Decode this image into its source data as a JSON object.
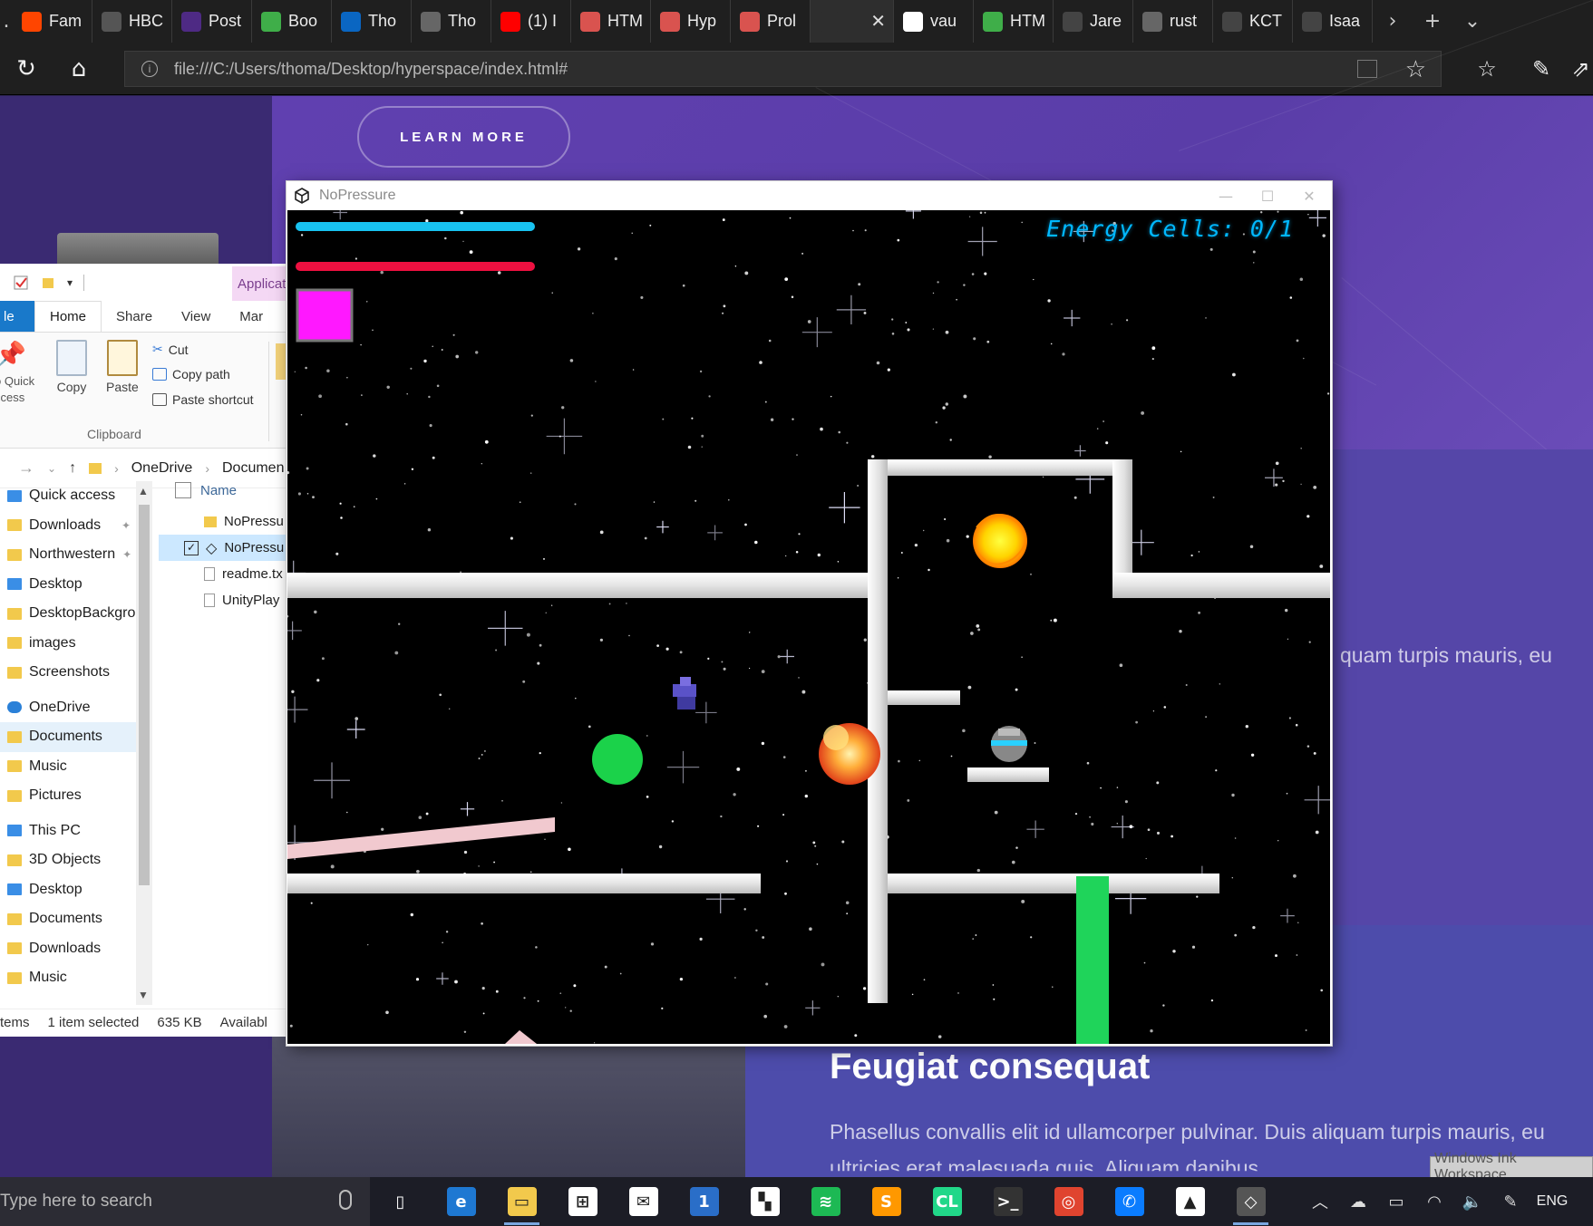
{
  "browser": {
    "tabs": [
      {
        "label": "Fam",
        "icon": "reddit-icon",
        "color": "#ff4500"
      },
      {
        "label": "HBC",
        "icon": "instagram-icon",
        "color": "#555555"
      },
      {
        "label": "Post",
        "icon": "northwestern-icon",
        "color": "#4e2a84"
      },
      {
        "label": "Boo",
        "icon": "html5up-icon",
        "color": "#3fae49"
      },
      {
        "label": "Tho",
        "icon": "linkedin-icon",
        "color": "#0a66c2"
      },
      {
        "label": "Tho",
        "icon": "pdf-icon",
        "color": "#666666"
      },
      {
        "label": "(1) I",
        "icon": "youtube-icon",
        "color": "#ff0000"
      },
      {
        "label": "HTM",
        "icon": "hsu-icon",
        "color": "#d9534f"
      },
      {
        "label": "Hyp",
        "icon": "hsu-icon",
        "color": "#d9534f"
      },
      {
        "label": "Prol",
        "icon": "hsu-icon",
        "color": "#d9534f"
      },
      {
        "label": "",
        "icon": "window-icon",
        "color": "#2e2e2e",
        "active": true
      },
      {
        "label": "vau",
        "icon": "google-icon",
        "color": "#ffffff"
      },
      {
        "label": "HTM",
        "icon": "html5up-icon",
        "color": "#3fae49"
      },
      {
        "label": "Jare",
        "icon": "terminal-icon",
        "color": "#444444"
      },
      {
        "label": "rust",
        "icon": "github-icon",
        "color": "#666666"
      },
      {
        "label": "KCT",
        "icon": "window-icon",
        "color": "#444444"
      },
      {
        "label": "Isaa",
        "icon": "window-icon",
        "color": "#444444"
      }
    ],
    "url": "file:///C:/Users/thoma/Desktop/hyperspace/index.html#"
  },
  "webpage": {
    "learn_more": "LEARN MORE",
    "snippet_right": "quam turpis mauris, eu",
    "heading": "Feugiat consequat",
    "para_line1": "Phasellus convallis elit id ullamcorper pulvinar. Duis aliquam turpis mauris, eu",
    "para_line2": "ultricies erat malesuada quis. Aliquam dapibus.",
    "ink_tooltip": "Windows Ink Workspace"
  },
  "explorer": {
    "tabs": {
      "file": "le",
      "home": "Home",
      "share": "Share",
      "view": "View",
      "manage": "Mar"
    },
    "application_tab": "Applicati",
    "ribbon": {
      "pin": "o Quick\nccess",
      "copy": "Copy",
      "paste": "Paste",
      "cut": "Cut",
      "copy_path": "Copy path",
      "paste_shortcut": "Paste shortcut",
      "group": "Clipboard"
    },
    "breadcrumb": [
      "OneDrive",
      "Documen"
    ],
    "nav": [
      {
        "label": "Quick access",
        "icon": "star-icon",
        "type": "blue"
      },
      {
        "label": "Downloads",
        "icon": "downloads-icon",
        "pinned": true
      },
      {
        "label": "Northwestern",
        "icon": "folder-icon",
        "pinned": true
      },
      {
        "label": "Desktop",
        "icon": "desktop-icon",
        "type": "blue"
      },
      {
        "label": "DesktopBackgro",
        "icon": "folder-icon"
      },
      {
        "label": "images",
        "icon": "folder-icon"
      },
      {
        "label": "Screenshots",
        "icon": "folder-icon"
      },
      {
        "label": "OneDrive",
        "icon": "cloud-icon",
        "type": "cloud",
        "gap": true
      },
      {
        "label": "Documents",
        "icon": "folder-icon",
        "selected": true
      },
      {
        "label": "Music",
        "icon": "folder-icon"
      },
      {
        "label": "Pictures",
        "icon": "folder-icon"
      },
      {
        "label": "This PC",
        "icon": "pc-icon",
        "type": "blue",
        "gap": true
      },
      {
        "label": "3D Objects",
        "icon": "3d-objects-icon"
      },
      {
        "label": "Desktop",
        "icon": "desktop-icon",
        "type": "blue"
      },
      {
        "label": "Documents",
        "icon": "documents-icon"
      },
      {
        "label": "Downloads",
        "icon": "downloads-icon"
      },
      {
        "label": "Music",
        "icon": "music-icon"
      }
    ],
    "files_header": "Name",
    "files": [
      {
        "name": "NoPressu",
        "kind": "folder"
      },
      {
        "name": "NoPressu",
        "kind": "unity",
        "selected": true
      },
      {
        "name": "readme.tx",
        "kind": "doc"
      },
      {
        "name": "UnityPlay",
        "kind": "doc"
      }
    ],
    "status": {
      "items": "tems",
      "selected": "1 item selected",
      "size": "635 KB",
      "avail": "Availabl"
    }
  },
  "game": {
    "window_title": "NoPressure",
    "energy_label": "Energy Cells: 0/1",
    "hud": {
      "bar1_color": "#18c2f0",
      "bar2_color": "#ee1040",
      "item_color": "#ff18ff"
    }
  },
  "taskbar": {
    "search_placeholder": "Type here to search",
    "lang": "ENG",
    "apps": [
      {
        "icon": "task-view-icon",
        "color": "transparent",
        "glyph": "▯"
      },
      {
        "icon": "edge-icon",
        "color": "#1e78d2",
        "glyph": "e"
      },
      {
        "icon": "file-explorer-icon",
        "color": "#f2c94c",
        "glyph": "▭",
        "running": true
      },
      {
        "icon": "store-icon",
        "color": "#ffffff",
        "glyph": "⊞"
      },
      {
        "icon": "mail-icon",
        "color": "#ffffff",
        "glyph": "✉"
      },
      {
        "icon": "calendar-icon",
        "color": "#2a6ec8",
        "glyph": "1"
      },
      {
        "icon": "sticky-notes-icon",
        "color": "#ffffff",
        "glyph": "▚"
      },
      {
        "icon": "spotify-icon",
        "color": "#1db954",
        "glyph": "≋"
      },
      {
        "icon": "sublime-icon",
        "color": "#ff9800",
        "glyph": "S"
      },
      {
        "icon": "clion-icon",
        "color": "#21d789",
        "glyph": "CL"
      },
      {
        "icon": "terminal-icon",
        "color": "#333333",
        "glyph": ">_"
      },
      {
        "icon": "chrome-icon",
        "color": "#e0442f",
        "glyph": "◎"
      },
      {
        "icon": "messenger-icon",
        "color": "#0a7cff",
        "glyph": "✆"
      },
      {
        "icon": "photos-icon",
        "color": "#ffffff",
        "glyph": "▲"
      },
      {
        "icon": "unity-icon",
        "color": "#555555",
        "glyph": "◇",
        "running": true
      }
    ]
  }
}
